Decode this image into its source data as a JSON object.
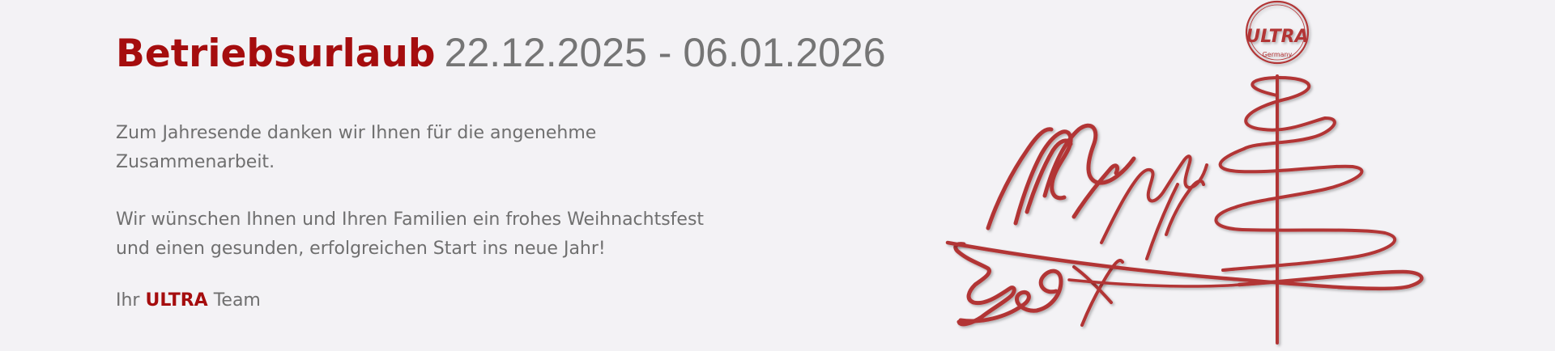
{
  "headline": {
    "title": "Betriebsurlaub",
    "dates": "22.12.2025 - 06.01.2026"
  },
  "paragraphs": {
    "p1": [
      "Zum Jahresende danken wir Ihnen für die angenehme",
      "Zusammenarbeit."
    ],
    "p2": [
      "Wir wünschen Ihnen und Ihren Familien ein frohes Weihnachtsfest",
      "und einen gesunden, erfolgreichen Start ins neue Jahr!"
    ],
    "signature": {
      "prefix": "Ihr",
      "brand": "ULTRA",
      "suffix": "Team"
    }
  },
  "artwork": {
    "logo_text": "ULTRA",
    "logo_subtext": "Germany",
    "script_text": "Merry Xmas",
    "accent_color": "#b23436",
    "title_color": "#a50d0e",
    "text_color": "#6f6f6f"
  }
}
